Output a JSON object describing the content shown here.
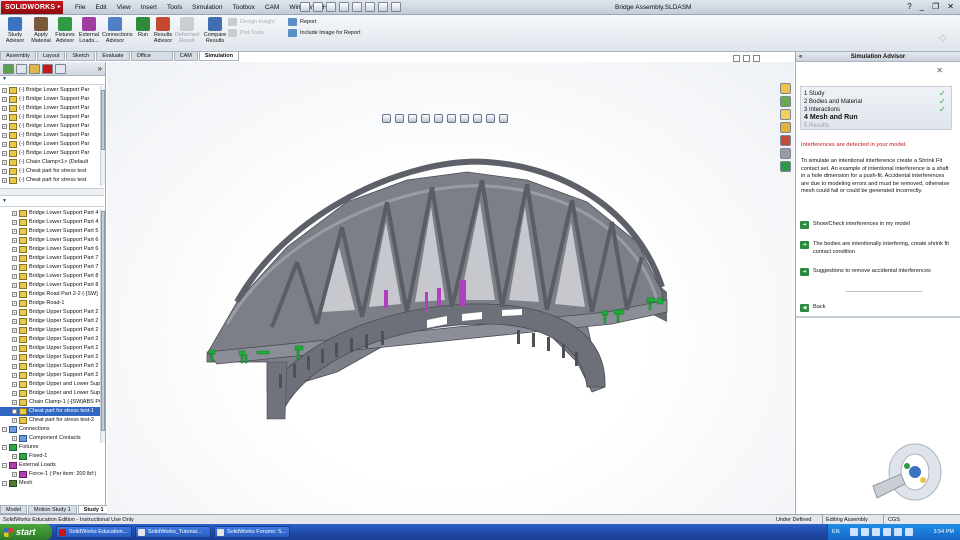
{
  "app": {
    "logo_text": "SOLIDWORKS",
    "document_title": "Bridge Assembly.SLDASM",
    "menus": [
      "File",
      "Edit",
      "View",
      "Insert",
      "Tools",
      "Simulation",
      "Toolbox",
      "CAM",
      "Window",
      "Help"
    ]
  },
  "ribbon": {
    "buttons": [
      {
        "label": "Study Advisor",
        "color": "#3b73c2"
      },
      {
        "label": "Apply Material",
        "color": "#7a5a3a"
      },
      {
        "label": "Fixtures Advisor",
        "color": "#2e9a44"
      },
      {
        "label": "External Loads...",
        "color": "#a23aa3"
      },
      {
        "label": "Connections Advisor",
        "color": "#4f7fc4"
      },
      {
        "label": "Run",
        "color": "#2f8a3a"
      },
      {
        "label": "Results Advisor",
        "color": "#c4492f"
      },
      {
        "label": "Deformed Result",
        "disabled": true,
        "color": "#8a8a8a"
      },
      {
        "label": "Compare Results",
        "color": "#3f6fb0"
      }
    ],
    "small_buttons": [
      {
        "label": "Design Insight",
        "disabled": true
      },
      {
        "label": "Plot Tools",
        "disabled": true
      },
      {
        "label": "Report",
        "disabled": false
      },
      {
        "label": "Include Image for Report",
        "disabled": false
      }
    ]
  },
  "command_tabs": [
    {
      "label": "Assembly",
      "active": false
    },
    {
      "label": "Layout",
      "active": false
    },
    {
      "label": "Sketch",
      "active": false
    },
    {
      "label": "Evaluate",
      "active": false
    },
    {
      "label": "Office Products",
      "active": false
    },
    {
      "label": "CAM",
      "active": false
    },
    {
      "label": "Simulation",
      "active": true
    }
  ],
  "feature_tree": {
    "items": [
      "(-) Bridge Lower Support Par",
      "(-) Bridge Lower Support Par",
      "(-) Bridge Lower Support Par",
      "(-) Bridge Lower Support Par",
      "(-) Bridge Lower Support Par",
      "(-) Bridge Lower Support Par",
      "(-) Bridge Lower Support Par",
      "(-) Bridge Lower Support Par",
      "(-) Chain Clamp<1> (Default",
      "(-) Cheat part for stress test",
      "(-) Cheat part for stress test"
    ]
  },
  "simulation_tree": {
    "parts": [
      {
        "label": "Bridge Lower Support Part 4",
        "selected": false
      },
      {
        "label": "Bridge Lower Support Part 4",
        "selected": false
      },
      {
        "label": "Bridge Lower Support Part 5",
        "selected": false
      },
      {
        "label": "Bridge Lower Support Part 6",
        "selected": false
      },
      {
        "label": "Bridge Lower Support Part 6",
        "selected": false
      },
      {
        "label": "Bridge Lower Support Part 7",
        "selected": false
      },
      {
        "label": "Bridge Lower Support Part 7",
        "selected": false
      },
      {
        "label": "Bridge Lower Support Part 8",
        "selected": false
      },
      {
        "label": "Bridge Lower Support Part 8",
        "selected": false
      },
      {
        "label": "Bridge Road Part 2-2 (-[SW]",
        "selected": false
      },
      {
        "label": "Bridge Road-1",
        "selected": false
      },
      {
        "label": "Bridge Upper Support Part 2",
        "selected": false
      },
      {
        "label": "Bridge Upper Support Part 2",
        "selected": false
      },
      {
        "label": "Bridge Upper Support Part 2",
        "selected": false
      },
      {
        "label": "Bridge Upper Support Part 2",
        "selected": false
      },
      {
        "label": "Bridge Upper Support Part 2",
        "selected": false
      },
      {
        "label": "Bridge Upper Support Part 2",
        "selected": false
      },
      {
        "label": "Bridge Upper Support Part 2",
        "selected": false
      },
      {
        "label": "Bridge Upper Support Part 2",
        "selected": false
      },
      {
        "label": "Bridge Upper and Lower Sup",
        "selected": false
      },
      {
        "label": "Bridge Upper and Lower Sup",
        "selected": false
      },
      {
        "label": "Chain Clamp-1 (-[SW]ABS PC",
        "selected": false
      },
      {
        "label": "Cheat part for stress test-1",
        "selected": true
      },
      {
        "label": "Cheat part for stress test-2",
        "selected": false
      }
    ],
    "sections": [
      {
        "label": "Connections",
        "kind": "conn",
        "indent": 0
      },
      {
        "label": "Component Contacts",
        "kind": "conn",
        "indent": 1
      },
      {
        "label": "Fixtures",
        "kind": "fix",
        "indent": 0
      },
      {
        "label": "Fixed-1",
        "kind": "fix",
        "indent": 1
      },
      {
        "label": "External Loads",
        "kind": "load",
        "indent": 0
      },
      {
        "label": "Force-1 (:Per item: 200 lbf:)",
        "kind": "load",
        "indent": 1
      },
      {
        "label": "Mesh",
        "kind": "mesh",
        "indent": 0
      }
    ]
  },
  "bottom_tabs": [
    {
      "label": "Model",
      "active": false
    },
    {
      "label": "Motion Study 1",
      "active": false
    },
    {
      "label": "Study 1",
      "active": true
    }
  ],
  "triad": {
    "x_label": "X",
    "y_label": "Y",
    "z_label": "Z"
  },
  "task_pane": {
    "title": "Simulation Advisor",
    "steps": [
      {
        "num": "1",
        "label": "Study",
        "state": "done"
      },
      {
        "num": "2",
        "label": "Bodies and Material",
        "state": "done"
      },
      {
        "num": "3",
        "label": "Interactions",
        "state": "done"
      },
      {
        "num": "4",
        "label": "Mesh and Run",
        "state": "current"
      },
      {
        "num": "5",
        "label": "Results",
        "state": "pending"
      }
    ],
    "warning": "Interferences are detected in your model.",
    "description": "To simulate an intentional interference create a Shrink Fit contact set. An example of intentional interference is a shaft in a hole dimension for a push-fit. Accidental interferences are due to modeling errors and must be removed, otherwise mesh could fail or could be generated incorrectly.",
    "links": [
      "Show/Check interferences in my model",
      "The bodies are intentionally interfering, create shrink fit contact condition",
      "Suggestions to remove accidental interferences"
    ],
    "back_label": "Back",
    "close_glyph": "✕"
  },
  "status_bar": {
    "edition": "SolidWorks Education Edition - Instructional Use Only",
    "state": "Under Defined",
    "mode": "Editing Assembly",
    "units": "CGS"
  },
  "taskbar": {
    "start_label": "start",
    "tasks": [
      {
        "label": "SolidWorks Education...",
        "kind": "sw"
      },
      {
        "label": "SolidWorks_Tutorial...",
        "kind": "doc"
      },
      {
        "label": "SolidWorks Forums: S...",
        "kind": "web"
      }
    ],
    "language": "EN",
    "clock": "3:54 PM"
  },
  "colors": {
    "bridge_fill": "#7d7f88",
    "bridge_dark": "#5e6069",
    "bridge_light": "#9a9ca5",
    "fixture": "#1fae3a",
    "load": "#b23ec0",
    "check": "#2ea043",
    "warning": "#c0161d"
  }
}
